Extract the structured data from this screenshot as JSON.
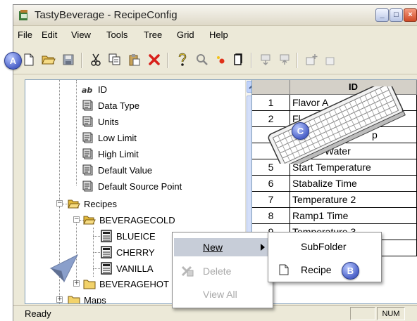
{
  "window": {
    "title": "TastyBeverage - RecipeConfig"
  },
  "menu": [
    "File",
    "Edit",
    "View",
    "Tools",
    "Tree",
    "Grid",
    "Help"
  ],
  "tree": {
    "items": [
      {
        "label": "ID",
        "icon": "id-icon"
      },
      {
        "label": "Data Type",
        "icon": "property-icon"
      },
      {
        "label": "Units",
        "icon": "property-icon"
      },
      {
        "label": "Low Limit",
        "icon": "property-icon"
      },
      {
        "label": "High Limit",
        "icon": "property-icon"
      },
      {
        "label": "Default Value",
        "icon": "property-icon"
      },
      {
        "label": "Default Source Point",
        "icon": "property-icon"
      },
      {
        "label": "Recipes",
        "icon": "folder-open-icon"
      },
      {
        "label": "BEVERAGECOLD",
        "icon": "folder-open-icon"
      },
      {
        "label": "BLUEICE",
        "icon": "recipe-icon"
      },
      {
        "label": "CHERRY",
        "icon": "recipe-icon"
      },
      {
        "label": "VANILLA",
        "icon": "recipe-icon"
      },
      {
        "label": "BEVERAGEHOT",
        "icon": "folder-icon"
      },
      {
        "label": "Maps",
        "icon": "folder-icon"
      }
    ]
  },
  "grid": {
    "header": "ID",
    "rows": [
      {
        "num": "1",
        "value": "Flavor A"
      },
      {
        "num": "2",
        "value": "Fl"
      },
      {
        "num": "",
        "value": "p"
      },
      {
        "num": "",
        "value": "ltered Water"
      },
      {
        "num": "5",
        "value": "Start Temperature"
      },
      {
        "num": "6",
        "value": "Stabalize Time"
      },
      {
        "num": "7",
        "value": "Temperature 2"
      },
      {
        "num": "8",
        "value": "Ramp1 Time"
      },
      {
        "num": "9",
        "value": "Temperature 3"
      },
      {
        "num": "",
        "value": ""
      }
    ]
  },
  "context_menu": {
    "items": [
      {
        "label": "New",
        "state": "highlighted"
      },
      {
        "label": "Delete",
        "state": "disabled"
      },
      {
        "label": "View All",
        "state": "disabled"
      }
    ]
  },
  "submenu": {
    "items": [
      {
        "label": "SubFolder"
      },
      {
        "label": "Recipe"
      }
    ]
  },
  "status": {
    "text": "Ready",
    "num": "NUM"
  },
  "badges": {
    "a": "A",
    "b": "B",
    "c": "C"
  },
  "colors": {
    "badge": "#4d63c9",
    "highlight": "#c7cdd8",
    "window_bg": "#ece9d8"
  }
}
